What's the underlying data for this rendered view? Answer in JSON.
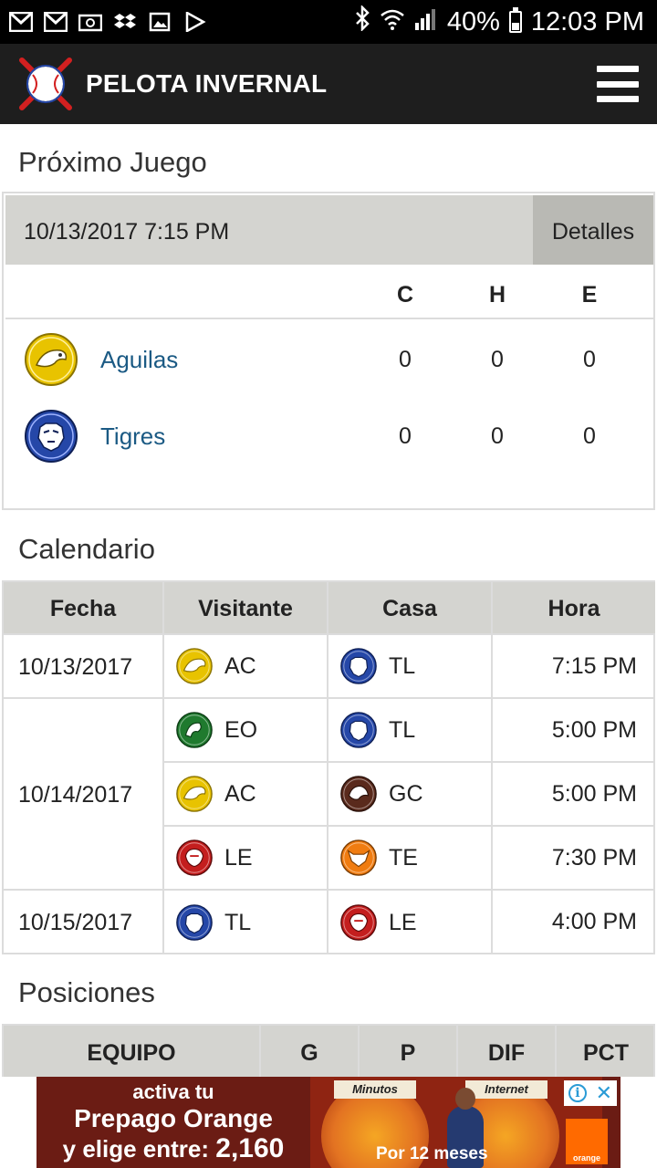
{
  "status_bar": {
    "battery": "40%",
    "battery_level": 0.4,
    "time": "12:03 PM",
    "left_icons": [
      "gmail-icon",
      "gmail-icon",
      "email-icon",
      "dropbox-icon",
      "gallery-icon",
      "play-store-icon"
    ]
  },
  "app": {
    "title": "PELOTA INVERNAL"
  },
  "next_game": {
    "heading": "Próximo Juego",
    "datetime": "10/13/2017 7:15 PM",
    "details_label": "Detalles",
    "columns": [
      "C",
      "H",
      "E"
    ],
    "teams": [
      {
        "name": "Aguilas",
        "logo": "aguilas-logo",
        "color": "#e8c300",
        "C": "0",
        "H": "0",
        "E": "0"
      },
      {
        "name": "Tigres",
        "logo": "tigres-logo",
        "color": "#2547a8",
        "C": "0",
        "H": "0",
        "E": "0"
      }
    ]
  },
  "schedule": {
    "heading": "Calendario",
    "columns": [
      "Fecha",
      "Visitante",
      "Casa",
      "Hora"
    ],
    "dates": [
      "10/13/2017",
      "10/14/2017",
      "10/15/2017"
    ],
    "games": [
      {
        "visitor": "AC",
        "home": "TL",
        "time": "7:15 PM"
      },
      {
        "visitor": "EO",
        "home": "TL",
        "time": "5:00 PM"
      },
      {
        "visitor": "AC",
        "home": "GC",
        "time": "5:00 PM"
      },
      {
        "visitor": "LE",
        "home": "TE",
        "time": "7:30 PM"
      },
      {
        "visitor": "TL",
        "home": "LE",
        "time": "4:00 PM"
      }
    ]
  },
  "standings": {
    "heading": "Posiciones",
    "columns": [
      "EQUIPO",
      "G",
      "P",
      "DIF",
      "PCT"
    ]
  },
  "ad": {
    "line1": "activa tu",
    "line2": "Prepago Orange",
    "line3_text": "y elige entre:",
    "line3_num": "2,160",
    "tag1": "Minutos",
    "tag2": "Internet",
    "sub": "Por 12 meses",
    "brand": "orange"
  },
  "colors": {
    "appbar": "#1e1e1e",
    "header_gray": "#d4d4d0",
    "link_blue": "#1b5a84",
    "aguilas": "#e8c300",
    "tigres": "#2547a8",
    "estrellas": "#1f7a2e",
    "gigantes": "#5a2a1c",
    "leones": "#c41e1e",
    "toros": "#f07c10"
  }
}
